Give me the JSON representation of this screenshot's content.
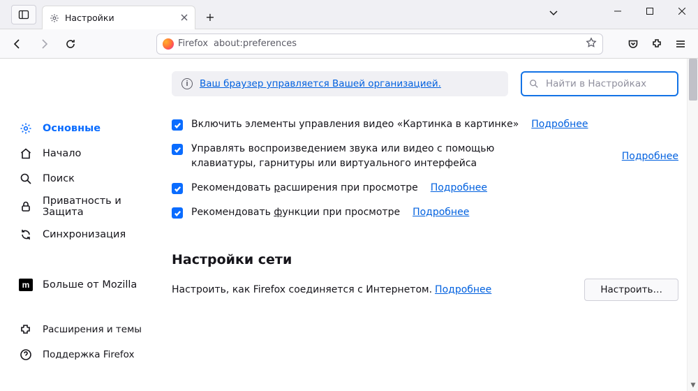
{
  "window": {
    "tab_title": "Настройки"
  },
  "urlbar": {
    "identity": "Firefox",
    "url": "about:preferences"
  },
  "sidebar": {
    "items": [
      {
        "id": "general",
        "label": "Основные"
      },
      {
        "id": "home",
        "label": "Начало"
      },
      {
        "id": "search",
        "label": "Поиск"
      },
      {
        "id": "privacy",
        "label": "Приватность и Защита"
      },
      {
        "id": "sync",
        "label": "Синхронизация"
      },
      {
        "id": "more",
        "label": "Больше от Mozilla"
      }
    ],
    "footer": [
      {
        "id": "addons",
        "label": "Расширения и темы"
      },
      {
        "id": "support",
        "label": "Поддержка Firefox"
      }
    ]
  },
  "banner": {
    "text": "Ваш браузер управляется Вашей организацией."
  },
  "search": {
    "placeholder": "Найти в Настройках"
  },
  "checks": {
    "pip": {
      "label_pre": "Включить элементы управления видео «Картинка в картинке»",
      "more": "Подробнее"
    },
    "media": {
      "label_pre": "Управлять воспроизведением звука или видео с помощью клавиатуры, гарнитуры или виртуального интерфейса",
      "more": "Подробнее"
    },
    "ext": {
      "label_pre": "Рекомендовать ",
      "ak": "р",
      "label_post": "асширения при просмотре",
      "more": "Подробнее"
    },
    "feat": {
      "label_pre": "Рекомендовать ",
      "ak": "ф",
      "label_post": "ункции при просмотре",
      "more": "Подробнее"
    }
  },
  "network": {
    "title": "Настройки сети",
    "desc": "Настроить, как Firefox соединяется с Интернетом.",
    "more": "Подробнее",
    "button": "Настроить…"
  }
}
